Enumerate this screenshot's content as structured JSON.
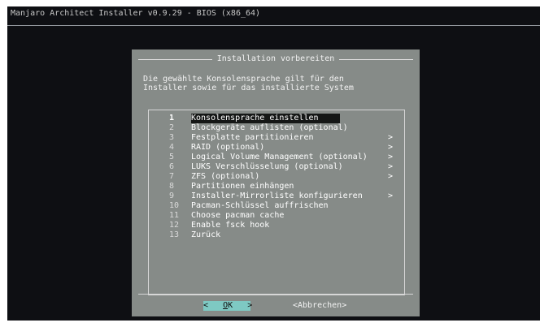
{
  "window": {
    "title": "Manjaro Architect Installer v0.9.29 - BIOS (x86_64)"
  },
  "dialog": {
    "title": "Installation vorbereiten",
    "desc_line1": "Die gewählte Konsolensprache gilt für den",
    "desc_line2": "Installer sowie für das installierte System",
    "menu": [
      {
        "num": "1",
        "label": "Konsolensprache einstellen",
        "arrow": "",
        "selected": true
      },
      {
        "num": "2",
        "label": "Blockgeräte auflisten (optional)",
        "arrow": ""
      },
      {
        "num": "3",
        "label": "Festplatte partitionieren",
        "arrow": ">"
      },
      {
        "num": "4",
        "label": "RAID (optional)",
        "arrow": ">"
      },
      {
        "num": "5",
        "label": "Logical Volume Management (optional)",
        "arrow": ">"
      },
      {
        "num": "6",
        "label": "LUKS Verschlüsselung (optional)",
        "arrow": ">"
      },
      {
        "num": "7",
        "label": "ZFS (optional)",
        "arrow": ">"
      },
      {
        "num": "8",
        "label": "Partitionen einhängen",
        "arrow": ""
      },
      {
        "num": "9",
        "label": "Installer-Mirrorliste konfigurieren",
        "arrow": ">"
      },
      {
        "num": "10",
        "label": "Pacman-Schlüssel auffrischen",
        "arrow": ""
      },
      {
        "num": "11",
        "label": "Choose pacman cache",
        "arrow": ""
      },
      {
        "num": "12",
        "label": "Enable fsck hook",
        "arrow": ""
      },
      {
        "num": "13",
        "label": "Zurück",
        "arrow": ""
      }
    ],
    "buttons": {
      "ok_left": "<",
      "ok_hot": "O",
      "ok_rest": "K",
      "ok_right": ">",
      "cancel": "<Abbrechen>"
    }
  },
  "colors": {
    "screen_bg": "#0e0f13",
    "dialog_bg": "#868b88",
    "selection_bg": "#151716",
    "ok_button_bg": "#7ec9c3"
  }
}
